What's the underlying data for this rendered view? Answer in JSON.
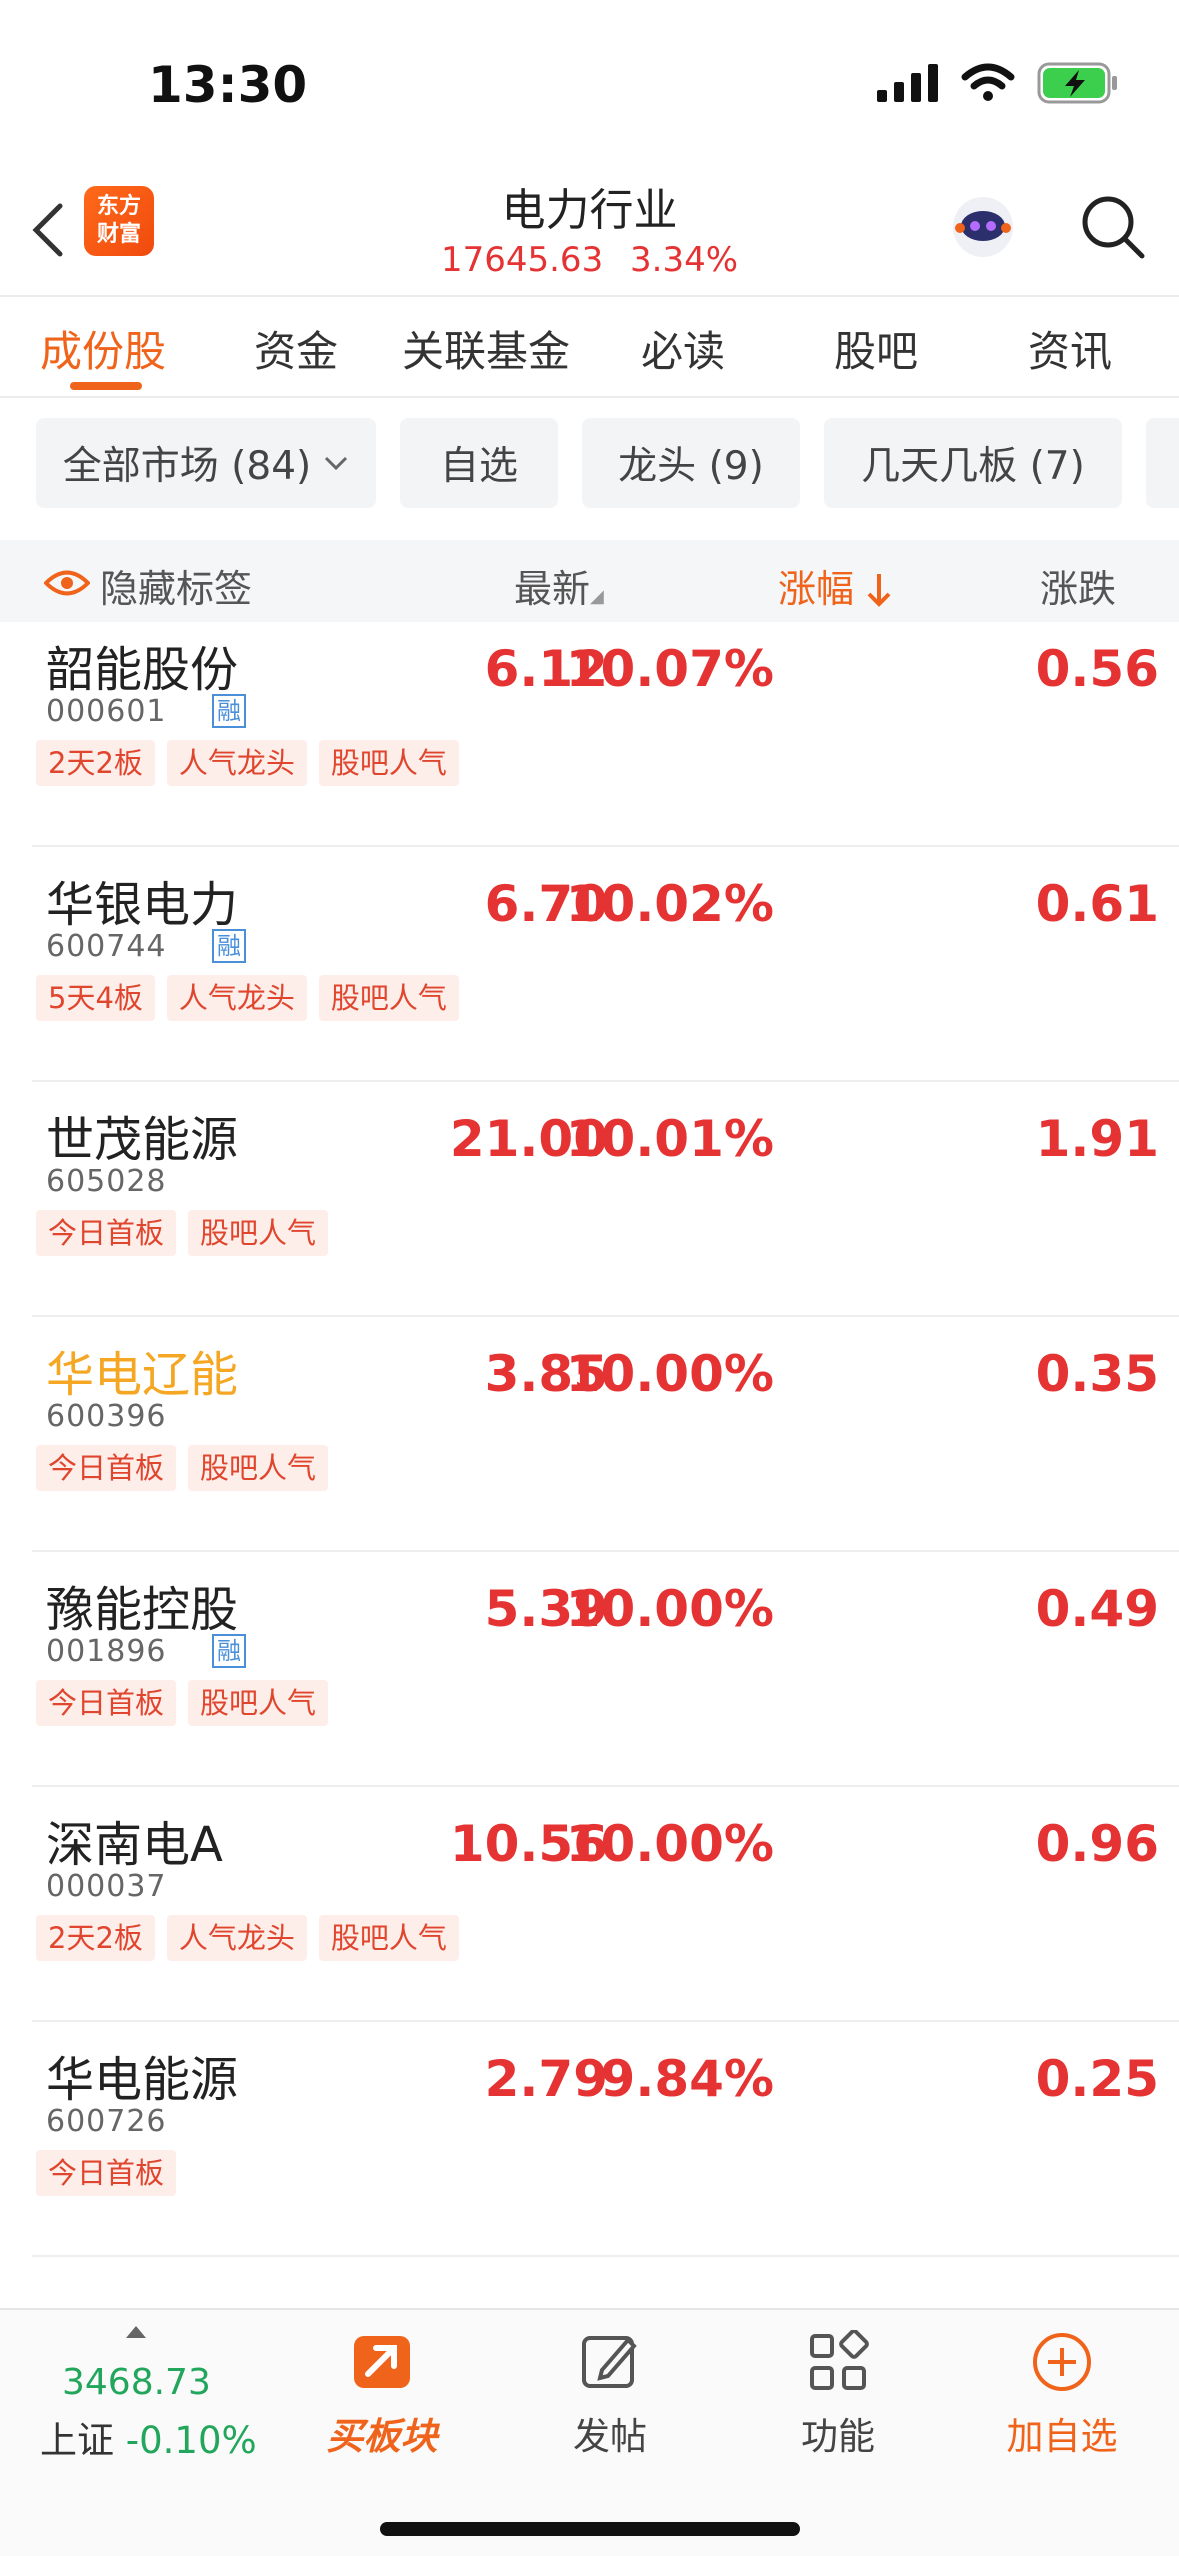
{
  "status": {
    "time": "13:30"
  },
  "header": {
    "logo_line1": "东方",
    "logo_line2": "财富",
    "title": "电力行业",
    "index_value": "17645.63",
    "index_change": "3.34%"
  },
  "tabs": [
    "成份股",
    "资金",
    "关联基金",
    "必读",
    "股吧",
    "资讯"
  ],
  "filters": [
    "全部市场 (84)",
    "自选",
    "龙头 (9)",
    "几天几板 (7)"
  ],
  "columns": {
    "hide_tags": "隐藏标签",
    "latest": "最新",
    "change_pct": "涨幅",
    "change_amt": "涨跌"
  },
  "stocks": [
    {
      "name": "韶能股份",
      "code": "000601",
      "rong": "融",
      "price": "6.12",
      "pct": "10.07%",
      "chg": "0.56",
      "tags": [
        "2天2板",
        "人气龙头",
        "股吧人气"
      ]
    },
    {
      "name": "华银电力",
      "code": "600744",
      "rong": "融",
      "price": "6.70",
      "pct": "10.02%",
      "chg": "0.61",
      "tags": [
        "5天4板",
        "人气龙头",
        "股吧人气"
      ]
    },
    {
      "name": "世茂能源",
      "code": "605028",
      "rong": "",
      "price": "21.00",
      "pct": "10.01%",
      "chg": "1.91",
      "tags": [
        "今日首板",
        "股吧人气"
      ]
    },
    {
      "name": "华电辽能",
      "code": "600396",
      "rong": "",
      "price": "3.85",
      "pct": "10.00%",
      "chg": "0.35",
      "tags": [
        "今日首板",
        "股吧人气"
      ],
      "highlight_color": "#f5a623"
    },
    {
      "name": "豫能控股",
      "code": "001896",
      "rong": "融",
      "price": "5.39",
      "pct": "10.00%",
      "chg": "0.49",
      "tags": [
        "今日首板",
        "股吧人气"
      ]
    },
    {
      "name": "深南电A",
      "code": "000037",
      "rong": "",
      "price": "10.56",
      "pct": "10.00%",
      "chg": "0.96",
      "tags": [
        "2天2板",
        "人气龙头",
        "股吧人气"
      ]
    },
    {
      "name": "华电能源",
      "code": "600726",
      "rong": "",
      "price": "2.79",
      "pct": "9.84%",
      "chg": "0.25",
      "tags": [
        "今日首板"
      ]
    }
  ],
  "bottom": {
    "index_value": "3468.73",
    "index_name": "上证",
    "index_change": "-0.10%",
    "buttons": [
      "买板块",
      "发帖",
      "功能",
      "加自选"
    ]
  },
  "colors": {
    "accent": "#f0631b",
    "up": "#e53232",
    "down": "#21a65b"
  }
}
